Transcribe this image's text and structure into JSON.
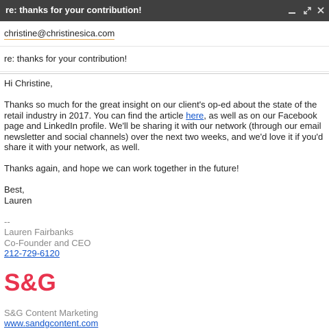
{
  "window": {
    "title": "re: thanks for your contribution!",
    "minimize_glyph": "_",
    "popout_glyph": "⤢",
    "close_glyph": "✕"
  },
  "to": {
    "value": "christine@christinesica.com"
  },
  "subject": {
    "value": "re: thanks for your contribution!"
  },
  "body": {
    "greeting": "Hi Christine,",
    "p1_before_link": "Thanks so much for the great insight on our client's op-ed about the state of the retail industry in 2017. You can find the article ",
    "p1_link": "here",
    "p1_after_link": ", as well as on our Facebook page and LinkedIn profile. We'll be sharing it with our network (through our email newsletter and social channels) over the next two weeks, and we'd love it if you'd share it with your network, as well.",
    "p2": "Thanks again, and hope we can work together in the future!",
    "closing": "Best,",
    "closing_name": "Lauren"
  },
  "signature": {
    "separator": "--",
    "name": "Lauren Fairbanks",
    "role": "Co-Founder and CEO",
    "phone": "212-729-6120",
    "logo_text": "S&G",
    "company": "S&G Content Marketing",
    "website": "www.sandgcontent.com"
  },
  "colors": {
    "titlebar_bg": "#404040",
    "link": "#1155cc",
    "logo": "#e8344e",
    "signature_gray": "#888888"
  }
}
